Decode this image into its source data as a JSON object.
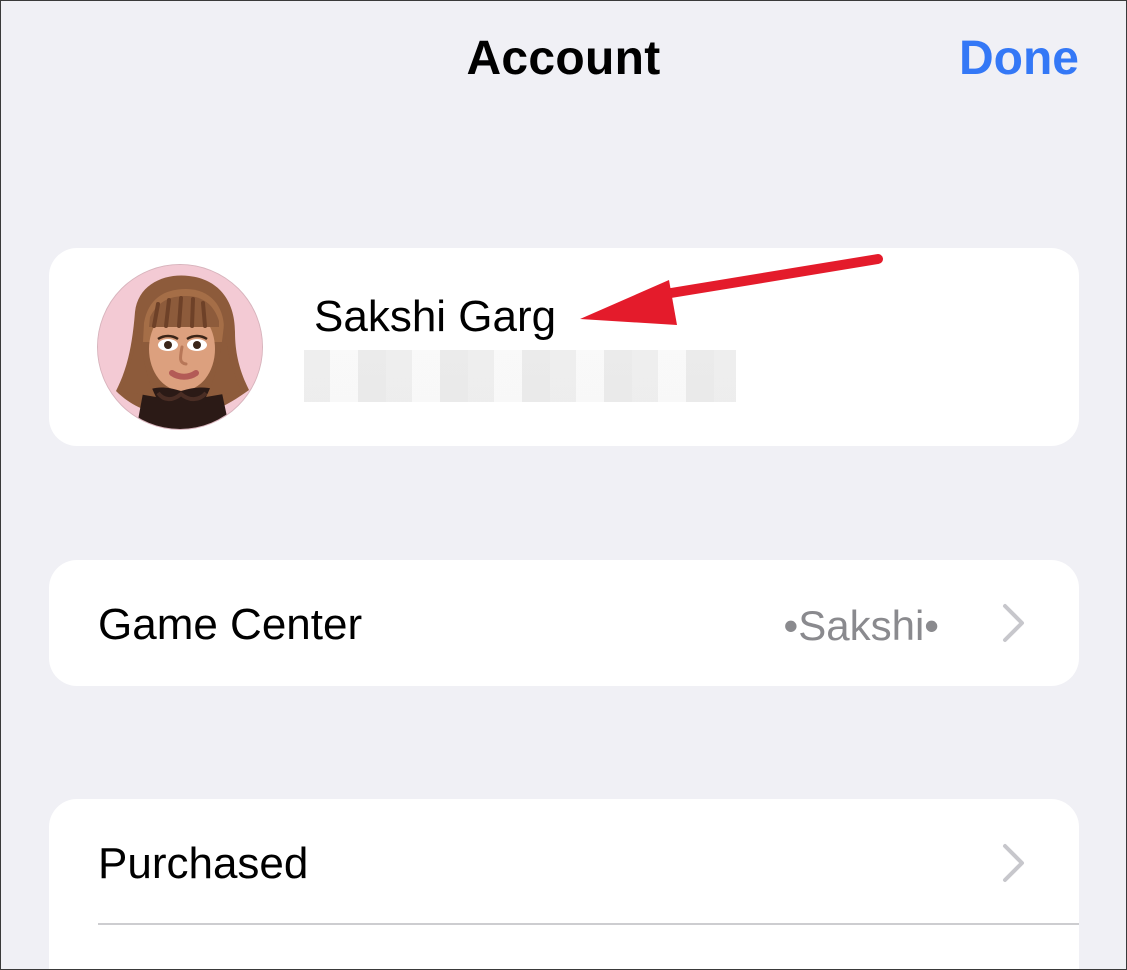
{
  "header": {
    "title": "Account",
    "done_label": "Done"
  },
  "profile": {
    "name": "Sakshi Garg",
    "avatar_icon": "memoji-avatar-icon"
  },
  "game_center": {
    "label": "Game Center",
    "value": "•Sakshi•",
    "chevron_icon": "chevron-right-icon"
  },
  "purchased": {
    "label": "Purchased",
    "chevron_icon": "chevron-right-icon"
  },
  "colors": {
    "background": "#f0f0f5",
    "accent": "#3478f6",
    "annotation_arrow": "#e41b2b",
    "secondary_text": "#8a8a8e"
  }
}
